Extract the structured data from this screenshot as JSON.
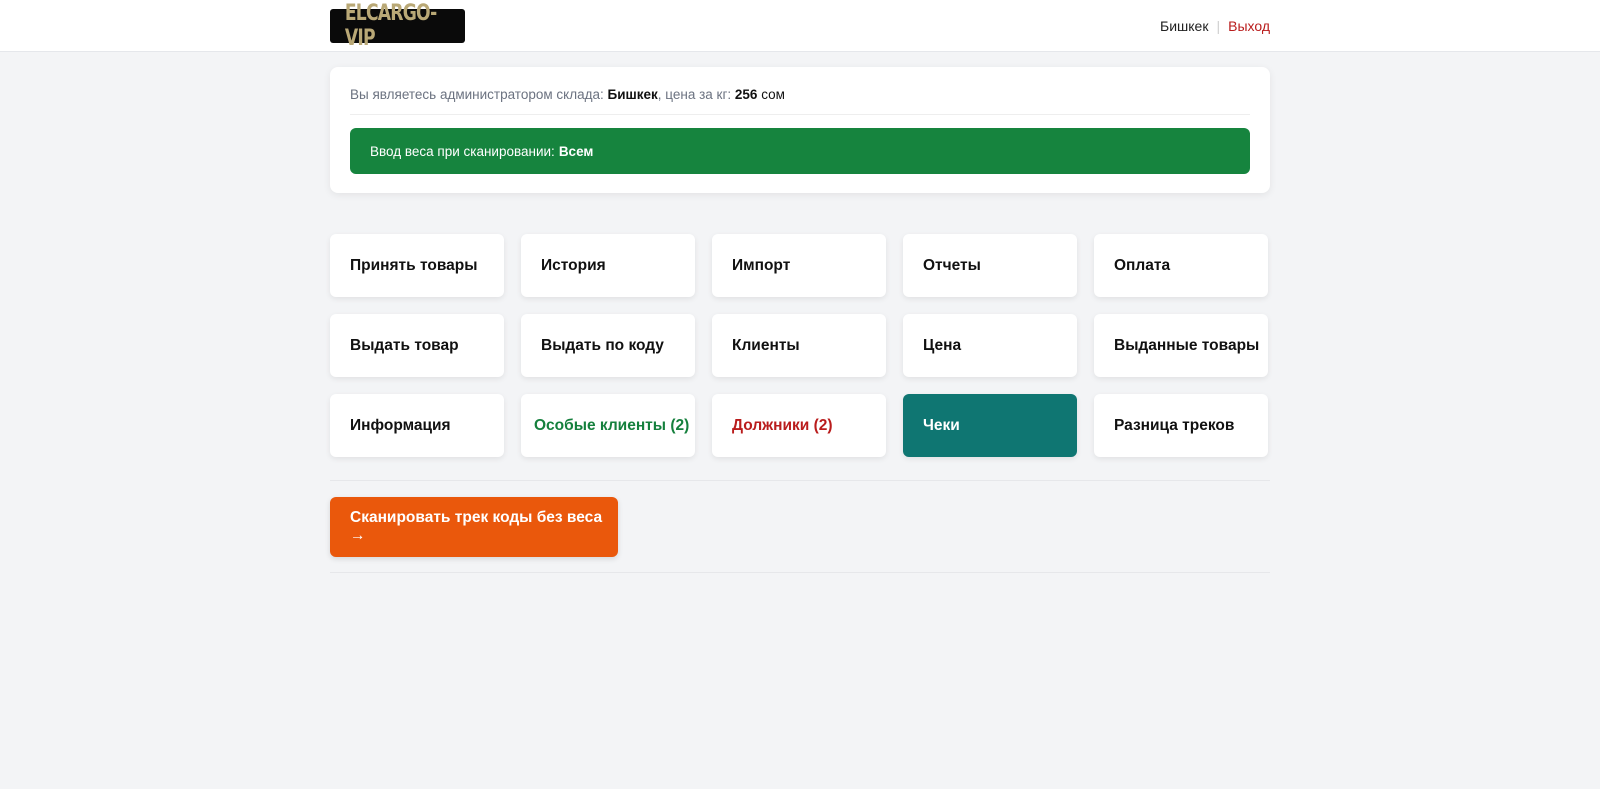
{
  "header": {
    "logo_text": "ELCARGO-VIP",
    "city": "Бишкек",
    "separator": "|",
    "logout_label": "Выход"
  },
  "info": {
    "admin_prefix": "Вы являетесь администратором склада:",
    "warehouse": "Бишкек",
    "price_prefix": ", цена за кг:",
    "price_value": "256",
    "currency": "сом"
  },
  "weight_banner": {
    "label": "Ввод веса при сканировании:",
    "value": "Всем"
  },
  "tiles": [
    {
      "label": "Принять товары"
    },
    {
      "label": "История"
    },
    {
      "label": "Импорт"
    },
    {
      "label": "Отчеты"
    },
    {
      "label": "Оплата"
    },
    {
      "label": "Выдать товар"
    },
    {
      "label": "Выдать по коду"
    },
    {
      "label": "Клиенты"
    },
    {
      "label": "Цена"
    },
    {
      "label": "Выданные товары"
    },
    {
      "label": "Информация"
    },
    {
      "label": "Особые клиенты (2)"
    },
    {
      "label": "Должники (2)"
    },
    {
      "label": "Чеки"
    },
    {
      "label": "Разница треков"
    }
  ],
  "scan_button": {
    "label": "Сканировать трек коды без веса →"
  },
  "colors": {
    "banner_green": "#16843e",
    "special_clients_green": "#15803d",
    "debtors_red": "#b91c1c",
    "receipts_teal": "#0f7672",
    "scan_orange": "#ea580c",
    "logout_red": "#b91c1c"
  }
}
